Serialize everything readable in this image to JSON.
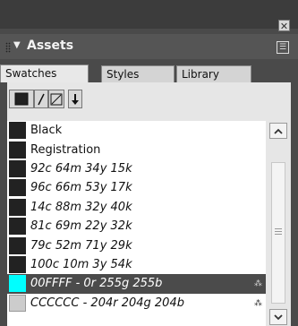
{
  "panel": {
    "title": "Assets",
    "close_glyph": "✕",
    "menu_glyph": "☰"
  },
  "tabs": [
    {
      "label": "Swatches"
    },
    {
      "label": "Styles"
    },
    {
      "label": "Library"
    }
  ],
  "toolbar": {
    "icons": [
      "fill-icon",
      "stroke-slash-icon",
      "none-icon",
      "down-arrow-icon"
    ]
  },
  "swatches": [
    {
      "label": "Black",
      "italic": false
    },
    {
      "label": "Registration",
      "italic": false
    },
    {
      "label": "92c 64m 34y 15k",
      "italic": true
    },
    {
      "label": "96c 66m 53y 17k",
      "italic": true
    },
    {
      "label": "14c 88m 32y 40k",
      "italic": true
    },
    {
      "label": "81c 69m 22y 32k",
      "italic": true
    },
    {
      "label": "79c 52m 71y 29k",
      "italic": true
    },
    {
      "label": "100c 10m 3y 54k",
      "italic": true
    },
    {
      "label": "00FFFF - 0r 255g 255b",
      "italic": true,
      "selected": true
    },
    {
      "label": "CCCCCC - 204r 204g 204b",
      "italic": true
    }
  ],
  "colors": {
    "swatch_dark": "#222222",
    "selected_bg": "#4b4b4b",
    "selected_swatch": "#00ffff",
    "cccccc_swatch": "#cccccc"
  }
}
